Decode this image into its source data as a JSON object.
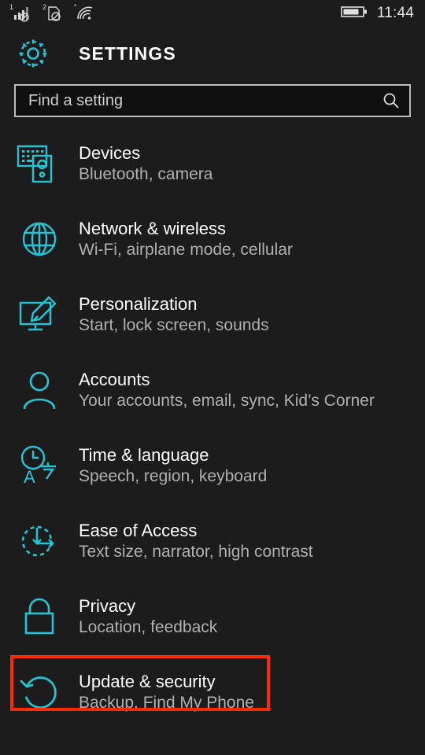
{
  "status_bar": {
    "signal_1_label": "1",
    "signal_2_label": "2",
    "wifi_label": "",
    "signal_1_icon": "cellular-signal-blocked-icon",
    "signal_2_icon": "sim-card-blocked-icon",
    "wifi_icon": "wifi-icon",
    "battery_icon": "battery-icon",
    "time": "11:44"
  },
  "header": {
    "gear_icon": "gear-icon",
    "title": "SETTINGS"
  },
  "search": {
    "placeholder": "Find a setting",
    "value": "",
    "icon": "search-icon"
  },
  "colors": {
    "background": "#1c1c1c",
    "accent": "#22c4d6",
    "title_text": "#ffffff",
    "sub_text": "#b0b0b0",
    "highlight": "#ff2a00"
  },
  "list": {
    "items": [
      {
        "title": "Devices",
        "subtitle": "Bluetooth, camera",
        "icon": "devices-keyboard-phone-icon",
        "highlighted": false
      },
      {
        "title": "Network & wireless",
        "subtitle": "Wi-Fi, airplane mode, cellular",
        "icon": "globe-icon",
        "highlighted": false
      },
      {
        "title": "Personalization",
        "subtitle": "Start, lock screen, sounds",
        "icon": "monitor-paintbrush-icon",
        "highlighted": false
      },
      {
        "title": "Accounts",
        "subtitle": "Your accounts, email, sync, Kid’s Corner",
        "icon": "person-icon",
        "highlighted": false
      },
      {
        "title": "Time & language",
        "subtitle": "Speech, region, keyboard",
        "icon": "clock-language-icon",
        "highlighted": false
      },
      {
        "title": "Ease of Access",
        "subtitle": "Text size, narrator, high contrast",
        "icon": "ease-of-access-icon",
        "highlighted": false
      },
      {
        "title": "Privacy",
        "subtitle": "Location, feedback",
        "icon": "padlock-icon",
        "highlighted": false
      },
      {
        "title": "Update & security",
        "subtitle": "Backup, Find My Phone",
        "icon": "refresh-circle-icon",
        "highlighted": true
      }
    ]
  }
}
